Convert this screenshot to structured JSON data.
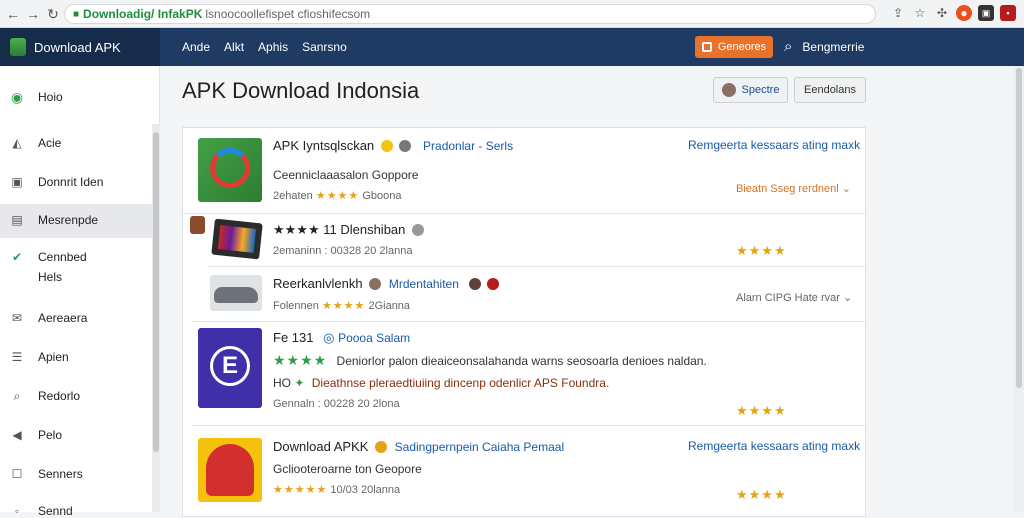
{
  "browser": {
    "host": "Downloadig/ InfakPK",
    "path": "lsnoocoollefispet cfioshifecsom"
  },
  "appbar": {
    "brand": "Download APK",
    "nav": [
      "Ande",
      "Alkt",
      "Aphis",
      "Sanrsno"
    ],
    "download_button": "Geneores",
    "search_label": "Bengmerrie"
  },
  "sidebar": {
    "items": [
      {
        "label": "Hoio",
        "icon": "home-icon"
      },
      {
        "label": "Acie",
        "icon": "apps-icon"
      },
      {
        "label": "Donnrit Iden",
        "icon": "download-icon"
      },
      {
        "label": "Mesrenpde",
        "icon": "message-icon"
      },
      {
        "label": "Cennbed",
        "label2": "Hels",
        "icon": "check-icon"
      },
      {
        "label": "Aereaera",
        "icon": "mail-icon"
      },
      {
        "label": "Apien",
        "icon": "list-icon"
      },
      {
        "label": "Redorlo",
        "icon": "search-icon"
      },
      {
        "label": "Pelo",
        "icon": "arrow-icon"
      },
      {
        "label": "Senners",
        "icon": "square-icon"
      },
      {
        "label": "Sennd",
        "icon": "more-icon"
      }
    ]
  },
  "main": {
    "title": "APK Download Indonsia",
    "button_spectre": "Spectre",
    "button_end": "Eendolans"
  },
  "apps": [
    {
      "title": "APK Iyntsqlsckan",
      "tag": "Pradonlar - Serls",
      "subtitle": "Ceenniclaaasalon Goppore",
      "meta_prefix": "2ehaten",
      "stars": "★★★★",
      "meta_suffix": "Gboona",
      "right_link": "Remgeerta kessaars ating maxk",
      "right_orange": "Bieatn Sseg rerdnenl"
    },
    {
      "title": "★★★★ 11 Dlenshiban",
      "meta": "2emaninn : 00328 20 2lanna",
      "right_stars": "★★★★"
    },
    {
      "title": "Reerkanlvlenkh",
      "tag": "Mrdentahiten",
      "meta_prefix": "Folennen",
      "stars": "★★★★",
      "meta_suffix": "2Gianna",
      "right_gray": "Alarn CIPG Hate rvar"
    },
    {
      "title": "Fe 131",
      "tag": "Poooa Salam",
      "stars": "★★★★",
      "desc1": "Deniorlor palon dieaiceonsalahanda warns seosoarla denioes naldan.",
      "desc2": "Dieathnse pleraedtiuiing dincenp odenlicr APS Foundra.",
      "desc2_prefix": "HO",
      "meta": "Gennaln : 00228 20 2lona",
      "right_stars": "★★★★"
    },
    {
      "title": "Download APKK",
      "tag": "Sadingpernpein Caiaha Pemaal",
      "subtitle": "Gcliooteroarne ton Geopore",
      "stars": "★★★★★",
      "meta_suffix": "10/03 20lanna",
      "right_link": "Remgeerta kessaars ating maxk",
      "right_stars": "★★★★"
    }
  ],
  "colors": {
    "appbar": "#1f3b63",
    "accent_orange": "#e8722c",
    "link_blue": "#1a5aa8",
    "star": "#e6a117"
  }
}
